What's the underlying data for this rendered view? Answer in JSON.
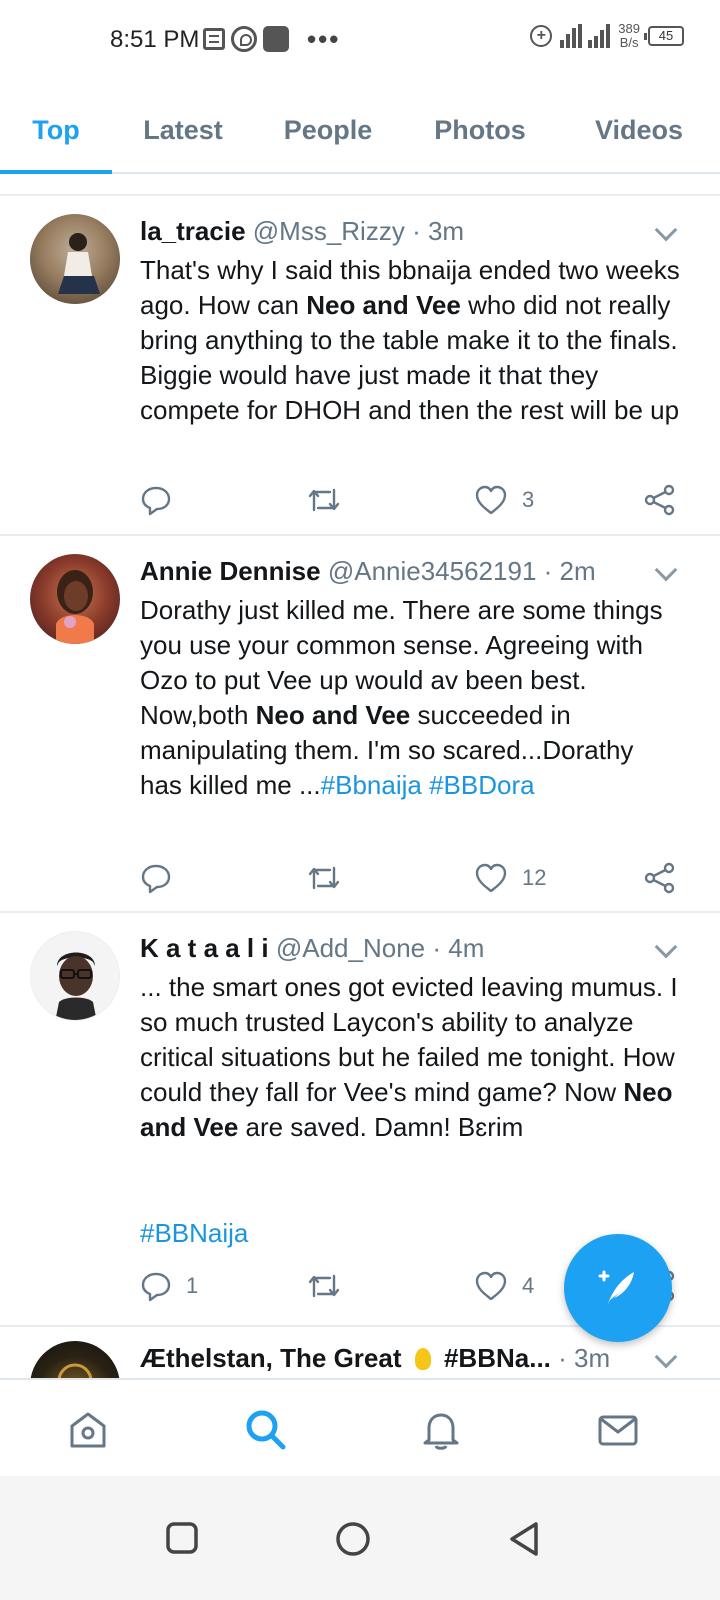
{
  "status_bar": {
    "time": "8:51 PM",
    "net_rate_value": "389",
    "net_rate_unit": "B/s",
    "battery": "45",
    "icons": [
      "notes-icon",
      "whatsapp-icon",
      "app-icon",
      "more-dots-icon",
      "plus-circle-icon",
      "signal-icon",
      "battery-icon"
    ]
  },
  "tabs": [
    {
      "label": "Top",
      "active": true
    },
    {
      "label": "Latest",
      "active": false
    },
    {
      "label": "People",
      "active": false
    },
    {
      "label": "Photos",
      "active": false
    },
    {
      "label": "Videos",
      "active": false
    }
  ],
  "tweets": [
    {
      "name": "la_tracie",
      "handle": "@Mss_Rizzy",
      "time": "· 3m",
      "body": [
        {
          "t": "That's why I said this bbnaija ended two weeks ago. How can "
        },
        {
          "b": "Neo and Vee"
        },
        {
          "t": " who did not really bring anything to the table make it to the finals. Biggie would have just made it that they compete for DHOH and then the rest will be up"
        }
      ],
      "reply_count": "",
      "retweet_count": "",
      "like_count": "3"
    },
    {
      "name": "Annie Dennise",
      "handle": "@Annie34562191",
      "time": "· 2m",
      "body": [
        {
          "t": "Dorathy just killed me. There are some things you use your common sense. Agreeing with Ozo to put Vee up would av been best. Now,both "
        },
        {
          "b": "Neo and Vee"
        },
        {
          "t": " succeeded in manipulating them. I'm so scared...Dorathy has killed me ..."
        },
        {
          "tag": "#Bbnaija"
        },
        {
          "t": " "
        },
        {
          "tag": "#BBDora"
        }
      ],
      "reply_count": "",
      "retweet_count": "",
      "like_count": "12"
    },
    {
      "name": "K a t a a l i",
      "handle": "@Add_None",
      "time": "· 4m",
      "body": [
        {
          "t": "... the smart ones got evicted leaving mumus. I so much trusted Laycon's ability to analyze critical situations but he failed me tonight. How could they fall for Vee's mind game? Now "
        },
        {
          "b": "Neo and Vee"
        },
        {
          "t": " are saved. Damn! Bɛrim"
        }
      ],
      "hashtag_line": "#BBNaija",
      "reply_count": "1",
      "retweet_count": "",
      "like_count": "4"
    },
    {
      "name": "Æthelstan, The Great",
      "name_suffix": "#BBNa...",
      "handle": "",
      "time": "· 3m"
    }
  ],
  "fab": {
    "icon": "compose-tweet-icon"
  },
  "bottom_nav": [
    {
      "icon": "home-icon",
      "active": false
    },
    {
      "icon": "search-icon",
      "active": true
    },
    {
      "icon": "notifications-icon",
      "active": false
    },
    {
      "icon": "messages-icon",
      "active": false
    }
  ],
  "system_nav": [
    "recents-icon",
    "home-circle-icon",
    "back-icon"
  ],
  "colors": {
    "accent": "#1da1f2",
    "link": "#1b95e0",
    "muted": "#657786",
    "divider": "#e6ecf0"
  }
}
